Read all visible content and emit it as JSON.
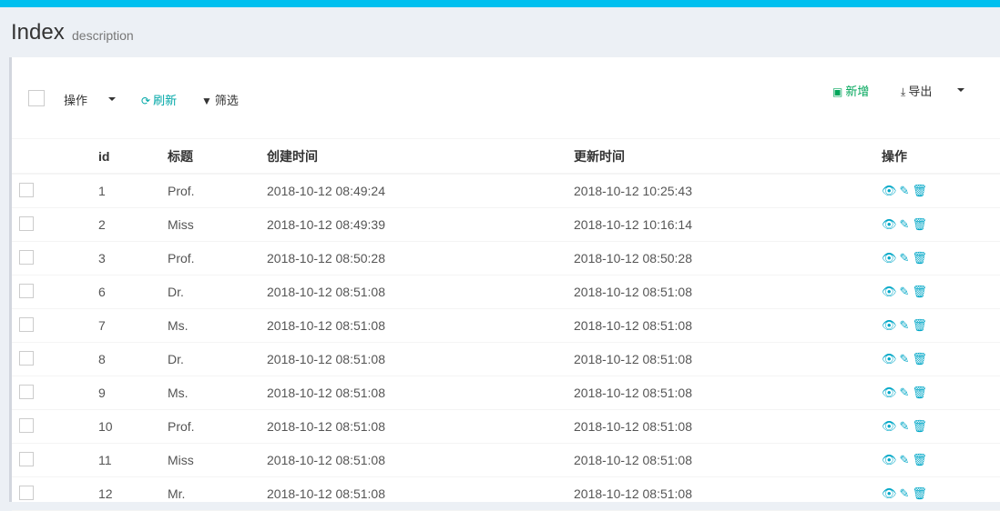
{
  "header": {
    "title": "Index",
    "description": "description"
  },
  "toolbar": {
    "ops_label": "操作",
    "refresh_label": "刷新",
    "filter_label": "筛选",
    "new_label": "新增",
    "export_label": "导出"
  },
  "table": {
    "columns": [
      "id",
      "标题",
      "创建时间",
      "更新时间",
      "操作"
    ],
    "rows": [
      {
        "id": "1",
        "title": "Prof.",
        "created": "2018-10-12 08:49:24",
        "updated": "2018-10-12 10:25:43"
      },
      {
        "id": "2",
        "title": "Miss",
        "created": "2018-10-12 08:49:39",
        "updated": "2018-10-12 10:16:14"
      },
      {
        "id": "3",
        "title": "Prof.",
        "created": "2018-10-12 08:50:28",
        "updated": "2018-10-12 08:50:28"
      },
      {
        "id": "6",
        "title": "Dr.",
        "created": "2018-10-12 08:51:08",
        "updated": "2018-10-12 08:51:08"
      },
      {
        "id": "7",
        "title": "Ms.",
        "created": "2018-10-12 08:51:08",
        "updated": "2018-10-12 08:51:08"
      },
      {
        "id": "8",
        "title": "Dr.",
        "created": "2018-10-12 08:51:08",
        "updated": "2018-10-12 08:51:08"
      },
      {
        "id": "9",
        "title": "Ms.",
        "created": "2018-10-12 08:51:08",
        "updated": "2018-10-12 08:51:08"
      },
      {
        "id": "10",
        "title": "Prof.",
        "created": "2018-10-12 08:51:08",
        "updated": "2018-10-12 08:51:08"
      },
      {
        "id": "11",
        "title": "Miss",
        "created": "2018-10-12 08:51:08",
        "updated": "2018-10-12 08:51:08"
      },
      {
        "id": "12",
        "title": "Mr.",
        "created": "2018-10-12 08:51:08",
        "updated": "2018-10-12 08:51:08"
      }
    ]
  },
  "colors": {
    "accent": "#00c0ef",
    "action": "#00a7c7",
    "new": "#00a65a"
  },
  "icons": {
    "view": "eye-icon",
    "edit": "edit-icon",
    "delete": "trash-icon"
  }
}
